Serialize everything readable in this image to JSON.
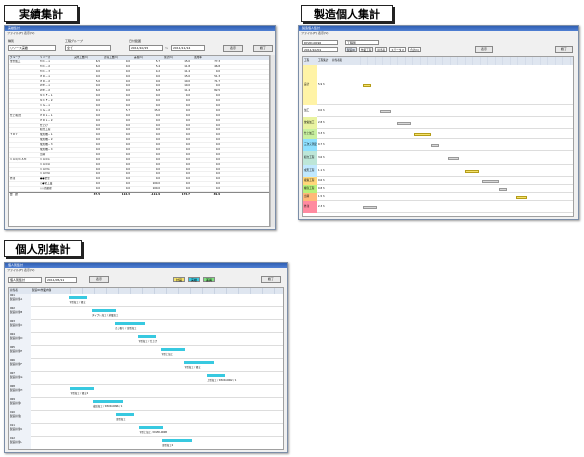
{
  "labels": {
    "jisseki": "実績集計",
    "seizou": "製造個人集計",
    "kojin": "個人別集計"
  },
  "jisseki": {
    "window_title": "実績集計",
    "menu": "ファイル(F)  表示(V)",
    "fields": {
      "type_label": "種別",
      "type_value": "リソース実績",
      "group_label": "工程グループ",
      "group_value": "全て",
      "date_label": "日付範囲",
      "date_from": "2011/10/15",
      "date_to": "2011/11/14"
    },
    "buttons": {
      "show": "表示",
      "close": "終了"
    },
    "columns": [
      "グループ",
      "リソース",
      "実際工数(h)",
      "計画工数(h)",
      "差異(h)",
      "累計(h)",
      "達成率"
    ],
    "rows": [
      [
        "金型加工",
        "ＭＣ－１",
        "6.5",
        "0.0",
        "5.7",
        "15.0",
        "77.3"
      ],
      [
        "",
        "ＭＣ－２",
        "6.0",
        "0.0",
        "5.4",
        "11.8",
        "46.8"
      ],
      [
        "",
        "ＭＣ－３",
        "0.0",
        "0.0",
        "4.2",
        "11.4",
        "0.0"
      ],
      [
        "",
        "ＥＤ－１",
        "0.0",
        "0.0",
        "0.0",
        "15.0",
        "51.3"
      ],
      [
        "",
        "ＥＤ－２",
        "5.0",
        "0.0",
        "0.6",
        "10.0",
        "71.7"
      ],
      [
        "",
        "ＷＥ－１",
        "0.0",
        "0.0",
        "0.0",
        "10.0",
        "0.0"
      ],
      [
        "",
        "ＷＥ－２",
        "6.0",
        "0.0",
        "6.8",
        "11.4",
        "82.5"
      ],
      [
        "",
        "ＮＣＦ－１",
        "0.0",
        "0.0",
        "0.0",
        "0.0",
        "0.0"
      ],
      [
        "",
        "ＮＣＦ－２",
        "0.0",
        "0.0",
        "0.0",
        "0.0",
        "0.0"
      ],
      [
        "",
        "ＣＧ－１",
        "0.0",
        "0.0",
        "0.0",
        "0.0",
        "0.0"
      ],
      [
        "",
        "ＣＧ－２",
        "0.1",
        "5.7",
        "15.0",
        "0.0",
        "0.0"
      ],
      [
        "仕上/組立",
        "ＰＤＬ－１",
        "0.0",
        "0.0",
        "0.0",
        "0.0",
        "0.0"
      ],
      [
        "",
        "ＰＤＬ－２",
        "0.0",
        "0.0",
        "0.0",
        "0.0",
        "0.0"
      ],
      [
        "",
        "仕上げ",
        "0.0",
        "0.0",
        "0.0",
        "0.0",
        "0.0"
      ],
      [
        "",
        "組立工程",
        "0.0",
        "0.0",
        "0.0",
        "0.0",
        "0.0"
      ],
      [
        "ＴＲＹ",
        "成形機－１",
        "0.0",
        "0.0",
        "0.0",
        "0.0",
        "0.0"
      ],
      [
        "",
        "成形機－２",
        "0.0",
        "0.0",
        "0.0",
        "0.0",
        "0.0"
      ],
      [
        "",
        "成形機－３",
        "0.0",
        "0.0",
        "0.0",
        "0.0",
        "0.0"
      ],
      [
        "",
        "成形機－４",
        "0.0",
        "0.0",
        "0.0",
        "0.0",
        "0.0"
      ],
      [
        "",
        "出荷",
        "0.0",
        "0.0",
        "0.0",
        "0.0",
        "0.0"
      ],
      [
        "ＣＡＤ/ＣＡＭ",
        "ＣＡＤ①",
        "0.0",
        "0.0",
        "0.0",
        "0.0",
        "0.0"
      ],
      [
        "",
        "ＣＡＤ②",
        "0.0",
        "0.0",
        "0.0",
        "0.0",
        "0.0"
      ],
      [
        "",
        "ＣＡＭ①",
        "0.0",
        "0.0",
        "0.0",
        "0.0",
        "0.0"
      ],
      [
        "",
        "ＣＡＭ②",
        "0.0",
        "0.0",
        "0.0",
        "0.0",
        "0.0"
      ],
      [
        "外注",
        "●●金型",
        "0.0",
        "0.0",
        "0.0",
        "0.0",
        "0.0"
      ],
      [
        "",
        "○●化工業",
        "0.0",
        "0.0",
        "100.0",
        "0.0",
        "0.0"
      ],
      [
        "",
        "◇◇熱処理",
        "0.0",
        "0.0",
        "100.0",
        "0.0",
        "0.0"
      ]
    ],
    "total": [
      "合　計",
      "",
      "37.5",
      "114.3",
      "-111.9",
      "174.7",
      "49.9"
    ]
  },
  "seizou": {
    "window_title": "製造個人集計",
    "menu": "ファイル(F)  表示(V)",
    "fields": {
      "code": "DIVID-0096",
      "proc_label": "工程別",
      "start": "2011/10/01"
    },
    "legend": [
      "製造ID",
      "作業工程",
      "担当者",
      "ステータス",
      "合計(h)"
    ],
    "show": "表示",
    "close": "終了",
    "columns": [
      "工程",
      "工程集計",
      "担当者名"
    ],
    "groups": [
      {
        "name": "設計",
        "sum": "5.9 h",
        "color": "#fff3a6"
      },
      {
        "name": "加工",
        "sum": "0.0 h",
        "color": "#ffffff"
      },
      {
        "name": "放電加工",
        "sum": "2.8 h",
        "color": "#e9f3a0"
      },
      {
        "name": "仕上加工",
        "sum": "3.3 h",
        "color": "#c8f0a0"
      },
      {
        "name": "三次元測定",
        "sum": "0.7 h",
        "color": "#8ee0ff"
      },
      {
        "name": "組立工程",
        "sum": "3.6 h",
        "color": "#bde6d8"
      },
      {
        "name": "成形工程",
        "sum": "1.1 h",
        "color": "#c0e8ff"
      },
      {
        "name": "検査工程",
        "sum": "0.6 h",
        "color": "#ffd77a"
      },
      {
        "name": "梱包工程",
        "sum": "0.8 h",
        "color": "#b8f07a"
      },
      {
        "name": "出荷",
        "sum": "1.5 h",
        "color": "#ffb878"
      },
      {
        "name": "外注",
        "sum": "2.3 h",
        "color": "#ff8aa0"
      }
    ]
  },
  "kojin": {
    "window_title": "個人別集計",
    "menu": "ファイル(F)  表示(V)",
    "fields": {
      "type_value": "個人別集計",
      "date": "2011/05/11"
    },
    "show": "表示",
    "close": "終了",
    "status_tags": [
      "計画",
      "実績",
      "差異"
    ],
    "status_colors": [
      "#f5e26a",
      "#38c9e0",
      "#7ee07e"
    ],
    "columns": [
      "担当者",
      "製造ID/作業内容"
    ],
    "people": [
      "001\n製造担当A",
      "002\n製造担当B",
      "003\n製造担当C",
      "004\n製造担当D",
      "005\n製造担当E",
      "006\n製造担当F",
      "007\n製造担当G",
      "008\n製造担当H",
      "009\n製造担当I",
      "010\n製造担当J",
      "011\n製造担当K",
      "012\n製造担当L"
    ],
    "bar_labels": [
      "下型加工 / 組立",
      "ダイプレ加工 / 放電加工",
      "カジ取り / 金型加工",
      "下型加工 / 仕上げ",
      "下型上加工",
      "下型加工 / 組立",
      "上型加工 / DIVID-0002 / 1",
      "下型加工 / 組立2",
      "成形加工 / DIVID-0096 / 1",
      "金型加工",
      "下型上加工 / DIVID-0098",
      "金型加工2"
    ]
  }
}
